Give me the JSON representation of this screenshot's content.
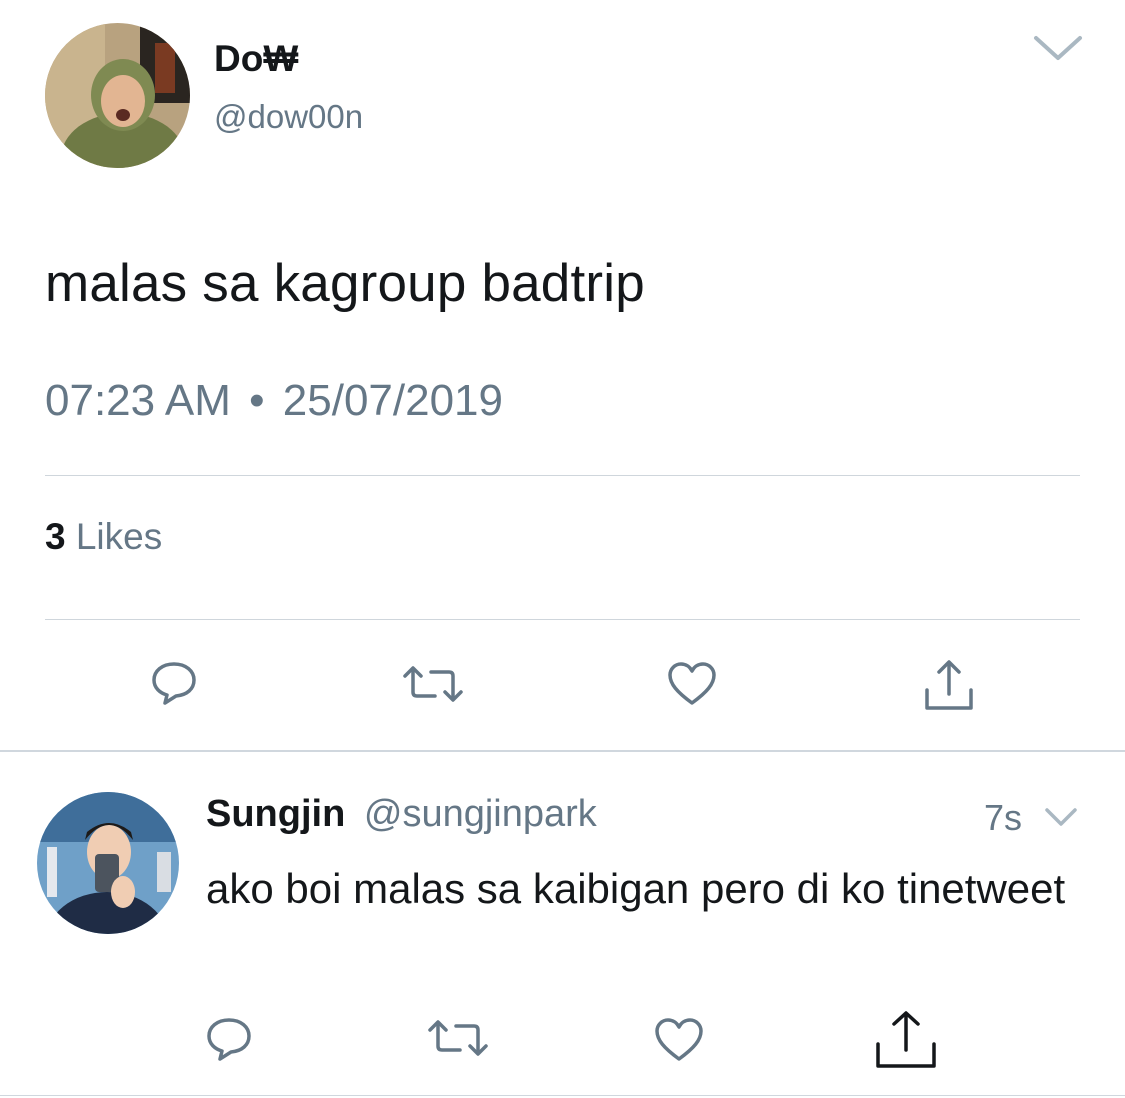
{
  "main_tweet": {
    "author_name": "Do₩",
    "author_handle": "@dow00n",
    "text": "malas sa kagroup badtrip",
    "time": "07:23 AM",
    "separator": "•",
    "date": "25/07/2019",
    "likes_count": "3",
    "likes_label": "Likes",
    "actions": [
      "reply-icon",
      "retweet-icon",
      "like-icon",
      "share-icon"
    ]
  },
  "reply": {
    "author_name": "Sungjin",
    "author_handle": "@sungjinpark",
    "time": "7s",
    "text": "ako boi malas sa kaibigan pero di ko tinetweet",
    "actions": [
      "reply-icon",
      "retweet-icon",
      "like-icon",
      "share-icon"
    ]
  },
  "colors": {
    "primary_text": "#14171a",
    "secondary_text": "#657786",
    "divider": "#cfd6dc",
    "icon": "#657786"
  }
}
